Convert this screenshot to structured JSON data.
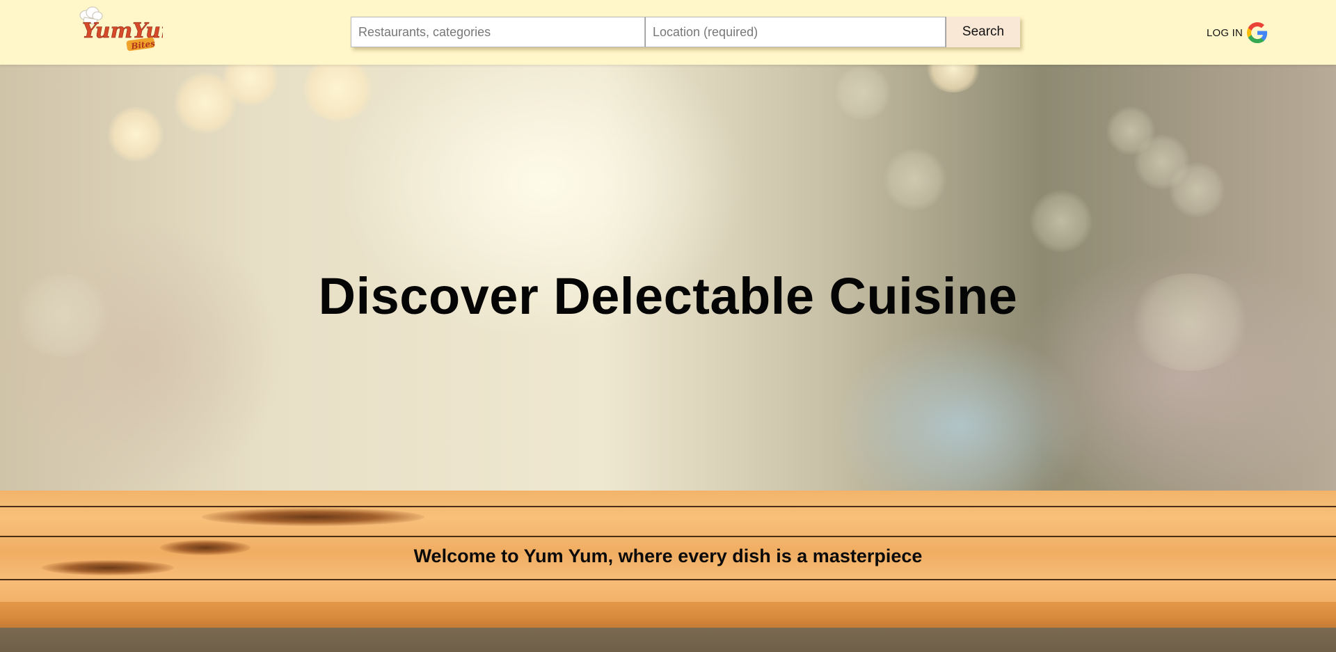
{
  "header": {
    "logo_primary": "YumYum",
    "logo_secondary": "Bites",
    "search": {
      "query_placeholder": "Restaurants, categories",
      "query_value": "",
      "location_placeholder": "Location (required)",
      "location_value": "",
      "button_label": "Search"
    },
    "login": {
      "label": "LOG IN",
      "icon": "google-icon"
    }
  },
  "hero": {
    "title": "Discover Delectable Cuisine"
  },
  "table_section": {
    "tagline": "Welcome to Yum Yum, where every dish is a masterpiece"
  },
  "colors": {
    "header_bg": "#fff6c9",
    "search_button_bg": "#fae8d7",
    "logo_red": "#d64a2a",
    "logo_orange": "#f0a32a"
  }
}
